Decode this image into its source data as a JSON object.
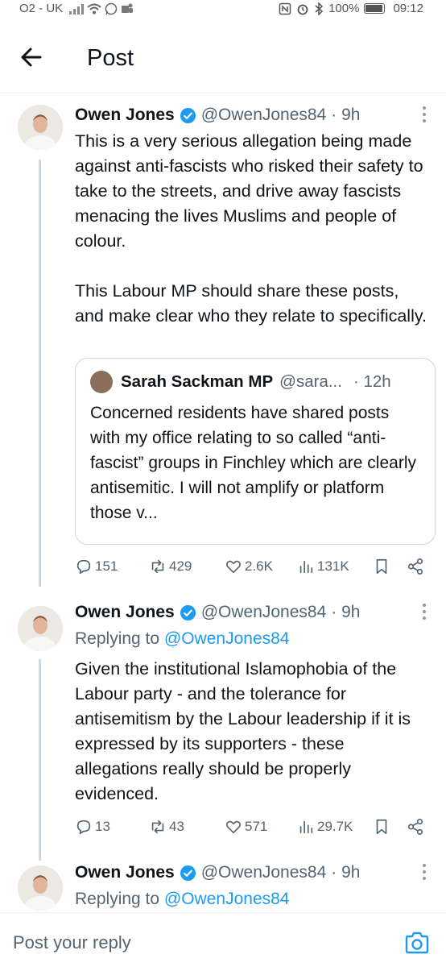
{
  "status_bar": {
    "carrier": "O2 - UK",
    "battery": "100%",
    "time": "09:12"
  },
  "header": {
    "title": "Post"
  },
  "posts": [
    {
      "name": "Owen Jones",
      "handle": "@OwenJones84",
      "time": "· 9h",
      "text": "This is a very serious allegation being made against anti-fascists who risked their safety to take to the streets, and drive away fascists menacing the lives Muslims and people of colour.\n\nThis Labour MP should share these posts, and make clear who they relate to specifically.",
      "quote": {
        "name": "Sarah Sackman MP",
        "handle": "@sara...",
        "time": "· 12h",
        "text": "Concerned residents have shared posts with my office relating to so called “anti-fascist” groups in Finchley which are clearly antisemitic. I will not amplify or platform those v..."
      },
      "stats": {
        "replies": "151",
        "reposts": "429",
        "likes": "2.6K",
        "views": "131K"
      }
    },
    {
      "name": "Owen Jones",
      "handle": "@OwenJones84",
      "time": "· 9h",
      "replying_prefix": "Replying to ",
      "replying_to": "@OwenJones84",
      "text": "Given the institutional Islamophobia of the Labour party - and the tolerance for antisemitism by the Labour leadership if it is expressed by its supporters - these allegations really should be properly evidenced.",
      "stats": {
        "replies": "13",
        "reposts": "43",
        "likes": "571",
        "views": "29.7K"
      }
    },
    {
      "name": "Owen Jones",
      "handle": "@OwenJones84",
      "time": "· 9h",
      "replying_prefix": "Replying to ",
      "replying_to": "@OwenJones84"
    }
  ],
  "reply_bar": {
    "placeholder": "Post your reply"
  },
  "colors": {
    "accent": "#1d9bf0",
    "text": "#0f1419",
    "secondary": "#536471",
    "border": "#cfd9de"
  },
  "icons": [
    "back-arrow-icon",
    "verified-badge-icon",
    "more-icon",
    "reply-icon",
    "repost-icon",
    "like-icon",
    "views-icon",
    "bookmark-icon",
    "share-icon",
    "camera-icon"
  ]
}
